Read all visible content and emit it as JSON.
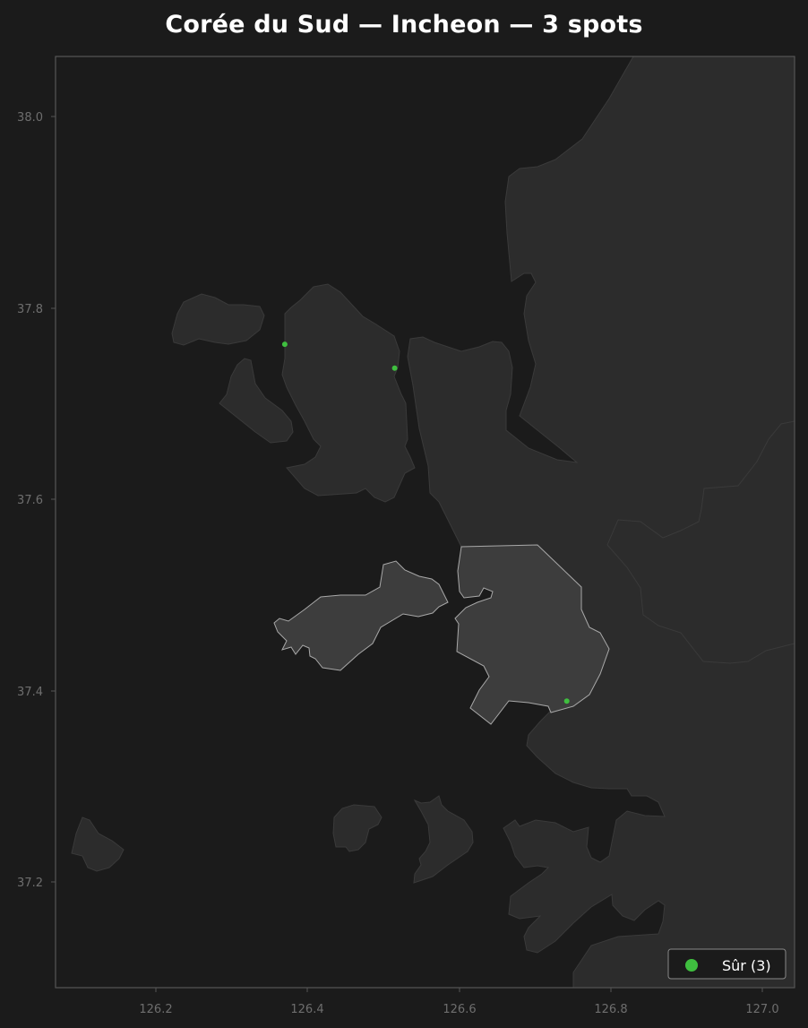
{
  "title": "Corée du Sud — Incheon — 3 spots",
  "colors": {
    "background": "#1b1b1b",
    "land": "#2c2c2c",
    "land_stroke": "#3a3a3a",
    "highlight": "#3d3d3d",
    "highlight_stroke": "#a8a8a8",
    "spot_safe": "#3fbf3f",
    "frame": "#555555"
  },
  "axes": {
    "x_ticks": [
      "126.2",
      "126.4",
      "126.6",
      "126.8",
      "127.0"
    ],
    "y_ticks": [
      "38.0",
      "37.8",
      "37.6",
      "37.4",
      "37.2"
    ]
  },
  "spots": [
    {
      "lon": 126.37,
      "lat": 37.762,
      "category": "safe"
    },
    {
      "lon": 126.515,
      "lat": 37.737,
      "category": "safe"
    },
    {
      "lon": 126.742,
      "lat": 37.389,
      "category": "safe"
    }
  ],
  "legend": {
    "entries": [
      {
        "label": "Sûr (3)",
        "color": "#3fbf3f",
        "icon": "circle-marker-icon"
      }
    ],
    "position": "bottom-right"
  }
}
